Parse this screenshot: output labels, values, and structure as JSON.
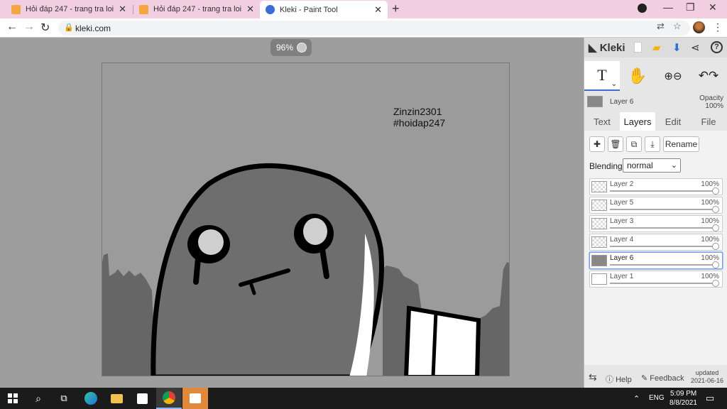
{
  "browser": {
    "tabs": [
      {
        "title": "Hỏi đáp 247 - trang tra loi",
        "active": false
      },
      {
        "title": "Hỏi đáp 247 - trang tra loi",
        "active": false
      },
      {
        "title": "Kleki - Paint Tool",
        "active": true
      }
    ],
    "url": "kleki.com",
    "colors": {
      "tab_bar": "#f2cfe0",
      "fav_hoidap": "#f4a640",
      "fav_kleki": "#3b6dd6"
    }
  },
  "canvas": {
    "zoom_label": "96%",
    "watermark": [
      "Zinzin2301",
      "#hoidap247"
    ]
  },
  "panel": {
    "logo": "Kleki",
    "current_layer": {
      "name": "Layer 6",
      "opacity_label": "Opacity",
      "opacity_value": "100%"
    },
    "tabs": [
      "Text",
      "Layers",
      "Edit",
      "File"
    ],
    "active_tab": "Layers",
    "rename_label": "Rename",
    "blending_label": "Blending",
    "blending_value": "normal",
    "layers": [
      {
        "name": "Layer 2",
        "opacity": "100%",
        "selected": false
      },
      {
        "name": "Layer 5",
        "opacity": "100%",
        "selected": false
      },
      {
        "name": "Layer 3",
        "opacity": "100%",
        "selected": false
      },
      {
        "name": "Layer 4",
        "opacity": "100%",
        "selected": false
      },
      {
        "name": "Layer 6",
        "opacity": "100%",
        "selected": true
      },
      {
        "name": "Layer 1",
        "opacity": "100%",
        "selected": false
      }
    ],
    "footer": {
      "help": "Help",
      "feedback": "Feedback",
      "updated_label": "updated",
      "updated_date": "2021-06-16"
    }
  },
  "taskbar": {
    "language": "ENG",
    "time": "5:09 PM",
    "date": "8/8/2021"
  }
}
